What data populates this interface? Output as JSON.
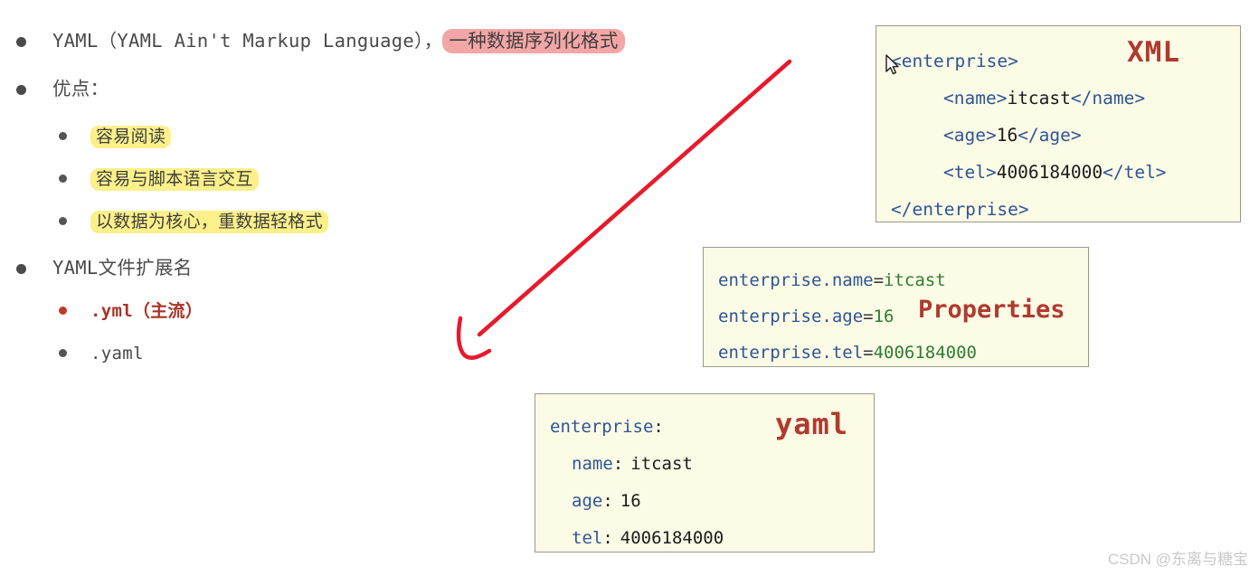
{
  "outline": {
    "items": [
      {
        "level": 1,
        "bullet": "dark",
        "prefix": "YAML（YAML Ain't Markup Language），",
        "highlight": "一种数据序列化格式",
        "highlight_color": "#f4a6a6"
      },
      {
        "level": 1,
        "bullet": "dark",
        "prefix": "优点：",
        "highlight": "",
        "highlight_color": ""
      },
      {
        "level": 2,
        "bullet": "dark",
        "prefix": "",
        "highlight": "容易阅读",
        "highlight_color": "#fbf08a"
      },
      {
        "level": 2,
        "bullet": "dark",
        "prefix": "",
        "highlight": "容易与脚本语言交互",
        "highlight_color": "#fbf08a"
      },
      {
        "level": 2,
        "bullet": "dark",
        "prefix": "",
        "highlight": "以数据为核心，重数据轻格式",
        "highlight_color": "#fbf08a"
      },
      {
        "level": 1,
        "bullet": "dark",
        "prefix": "YAML文件扩展名",
        "highlight": "",
        "highlight_color": ""
      },
      {
        "level": 2,
        "bullet": "red",
        "prefix": ".yml（主流）",
        "highlight": "",
        "highlight_color": "#a93226"
      },
      {
        "level": 2,
        "bullet": "dark",
        "prefix": ".yaml",
        "highlight": "",
        "highlight_color": ""
      }
    ],
    "line1_prefix": "YAML（YAML Ain't Markup Language），",
    "line1_highlight": "一种数据序列化格式",
    "line2": "优点：",
    "adv1": "容易阅读",
    "adv2": "容易与脚本语言交互",
    "adv3": "以数据为核心，重数据轻格式",
    "line3": "YAML文件扩展名",
    "ext1": ".yml（主流）",
    "ext2": ".yaml"
  },
  "xml_box": {
    "label": "XML",
    "label_color": "#b03a2e",
    "background": "#fbfbe6",
    "lines": [
      {
        "indent": 0,
        "tag_open": "<enterprise>",
        "content": "",
        "tag_close": ""
      },
      {
        "indent": 1,
        "tag_open": "<name>",
        "content": "itcast",
        "tag_close": "</name>"
      },
      {
        "indent": 1,
        "tag_open": "<age>",
        "content": "16",
        "tag_close": "</age>"
      },
      {
        "indent": 1,
        "tag_open": "<tel>",
        "content": "4006184000",
        "tag_close": "</tel>"
      },
      {
        "indent": 0,
        "tag_open": "</enterprise>",
        "content": "",
        "tag_close": ""
      }
    ],
    "l1": "<enterprise>",
    "l2_open": "<name>",
    "l2_val": "itcast",
    "l2_close": "</name>",
    "l3_open": "<age>",
    "l3_val": "16",
    "l3_close": "</age>",
    "l4_open": "<tel>",
    "l4_val": "4006184000",
    "l4_close": "</tel>",
    "l5": "</enterprise>"
  },
  "properties_box": {
    "label": "Properties",
    "label_color": "#b03a2e",
    "background": "#fbfbe6",
    "rows": [
      {
        "key": "enterprise.name",
        "value": "itcast"
      },
      {
        "key": "enterprise.age",
        "value": "16"
      },
      {
        "key": "enterprise.tel",
        "value": "4006184000"
      }
    ],
    "k1": "enterprise.name",
    "v1": "itcast",
    "k2": "enterprise.age",
    "v2": "16",
    "k3": "enterprise.tel",
    "v3": "4006184000",
    "separator": "="
  },
  "yaml_box": {
    "label": "yaml",
    "label_color": "#b03a2e",
    "background": "#fbfbe6",
    "rows": [
      {
        "indent": 0,
        "key": "enterprise",
        "value": ""
      },
      {
        "indent": 1,
        "key": "name",
        "value": "itcast"
      },
      {
        "indent": 1,
        "key": "age",
        "value": "16"
      },
      {
        "indent": 1,
        "key": "tel",
        "value": "4006184000"
      }
    ],
    "k0": "enterprise",
    "k1": "name",
    "v1": "itcast",
    "k2": "age",
    "v2": "16",
    "k3": "tel",
    "v3": "4006184000",
    "separator": ":"
  },
  "annotation": {
    "arrow_color": "#e8192c",
    "arrow_from": "873,68",
    "arrow_to": "528,372"
  },
  "watermark": {
    "text": "CSDN @东离与糖宝"
  }
}
